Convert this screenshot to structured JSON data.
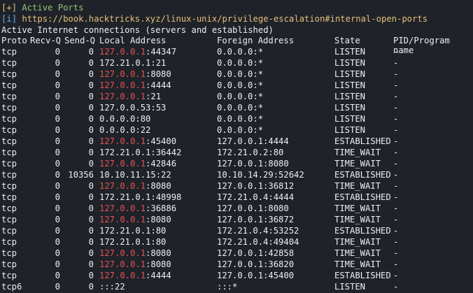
{
  "section": {
    "tag_open": "[",
    "tag_mark": "+",
    "tag_close": "]",
    "title": "Active Ports"
  },
  "info": {
    "tag_open": "[",
    "tag_mark": "i",
    "tag_close": "]",
    "url": "https://book.hacktricks.xyz/linux-unix/privilege-escalation#internal-open-ports"
  },
  "netstat_title": "Active Internet connections (servers and established)",
  "columns": {
    "proto": "Proto",
    "recv": "Recv-Q",
    "send": "Send-Q",
    "local": "Local Address",
    "foreign": "Foreign Address",
    "state": "State",
    "pid": "PID/Program name"
  },
  "rows": [
    {
      "proto": "tcp",
      "recv": "0",
      "send": "0",
      "local_host": "127.0.0.1",
      "local_port": ":44347",
      "local_hl": true,
      "foreign": "0.0.0.0:*",
      "state": "LISTEN",
      "pid": "-"
    },
    {
      "proto": "tcp",
      "recv": "0",
      "send": "0",
      "local_host": "172.21.0.1",
      "local_port": ":21",
      "local_hl": false,
      "foreign": "0.0.0.0:*",
      "state": "LISTEN",
      "pid": "-"
    },
    {
      "proto": "tcp",
      "recv": "0",
      "send": "0",
      "local_host": "127.0.0.1",
      "local_port": ":8080",
      "local_hl": true,
      "foreign": "0.0.0.0:*",
      "state": "LISTEN",
      "pid": "-"
    },
    {
      "proto": "tcp",
      "recv": "0",
      "send": "0",
      "local_host": "127.0.0.1",
      "local_port": ":4444",
      "local_hl": true,
      "foreign": "0.0.0.0:*",
      "state": "LISTEN",
      "pid": "-"
    },
    {
      "proto": "tcp",
      "recv": "0",
      "send": "0",
      "local_host": "127.0.0.1",
      "local_port": ":21",
      "local_hl": true,
      "foreign": "0.0.0.0:*",
      "state": "LISTEN",
      "pid": "-"
    },
    {
      "proto": "tcp",
      "recv": "0",
      "send": "0",
      "local_host": "127.0.0.53",
      "local_port": ":53",
      "local_hl": false,
      "foreign": "0.0.0.0:*",
      "state": "LISTEN",
      "pid": "-"
    },
    {
      "proto": "tcp",
      "recv": "0",
      "send": "0",
      "local_host": "0.0.0.0",
      "local_port": ":80",
      "local_hl": false,
      "foreign": "0.0.0.0:*",
      "state": "LISTEN",
      "pid": "-"
    },
    {
      "proto": "tcp",
      "recv": "0",
      "send": "0",
      "local_host": "0.0.0.0",
      "local_port": ":22",
      "local_hl": false,
      "foreign": "0.0.0.0:*",
      "state": "LISTEN",
      "pid": "-"
    },
    {
      "proto": "tcp",
      "recv": "0",
      "send": "0",
      "local_host": "127.0.0.1",
      "local_port": ":45400",
      "local_hl": true,
      "foreign": "127.0.0.1:4444",
      "state": "ESTABLISHED",
      "pid": "-"
    },
    {
      "proto": "tcp",
      "recv": "0",
      "send": "0",
      "local_host": "172.21.0.1",
      "local_port": ":36442",
      "local_hl": false,
      "foreign": "172.21.0.2:80",
      "state": "TIME_WAIT",
      "pid": "-"
    },
    {
      "proto": "tcp",
      "recv": "0",
      "send": "0",
      "local_host": "127.0.0.1",
      "local_port": ":42846",
      "local_hl": true,
      "foreign": "127.0.0.1:8080",
      "state": "TIME_WAIT",
      "pid": "-"
    },
    {
      "proto": "tcp",
      "recv": "0",
      "send": "10356",
      "local_host": "10.10.11.15",
      "local_port": ":22",
      "local_hl": false,
      "foreign": "10.10.14.29:52642",
      "state": "ESTABLISHED",
      "pid": "-"
    },
    {
      "proto": "tcp",
      "recv": "0",
      "send": "0",
      "local_host": "127.0.0.1",
      "local_port": ":8080",
      "local_hl": true,
      "foreign": "127.0.0.1:36812",
      "state": "TIME_WAIT",
      "pid": "-"
    },
    {
      "proto": "tcp",
      "recv": "0",
      "send": "0",
      "local_host": "172.21.0.1",
      "local_port": ":48998",
      "local_hl": false,
      "foreign": "172.21.0.4:4444",
      "state": "ESTABLISHED",
      "pid": "-"
    },
    {
      "proto": "tcp",
      "recv": "0",
      "send": "0",
      "local_host": "127.0.0.1",
      "local_port": ":36886",
      "local_hl": true,
      "foreign": "127.0.0.1:8080",
      "state": "TIME_WAIT",
      "pid": "-"
    },
    {
      "proto": "tcp",
      "recv": "0",
      "send": "0",
      "local_host": "127.0.0.1",
      "local_port": ":8080",
      "local_hl": true,
      "foreign": "127.0.0.1:36872",
      "state": "TIME_WAIT",
      "pid": "-"
    },
    {
      "proto": "tcp",
      "recv": "0",
      "send": "0",
      "local_host": "172.21.0.1",
      "local_port": ":80",
      "local_hl": false,
      "foreign": "172.21.0.4:53252",
      "state": "ESTABLISHED",
      "pid": "-"
    },
    {
      "proto": "tcp",
      "recv": "0",
      "send": "0",
      "local_host": "172.21.0.1",
      "local_port": ":80",
      "local_hl": false,
      "foreign": "172.21.0.4:49404",
      "state": "TIME_WAIT",
      "pid": "-"
    },
    {
      "proto": "tcp",
      "recv": "0",
      "send": "0",
      "local_host": "127.0.0.1",
      "local_port": ":8080",
      "local_hl": true,
      "foreign": "127.0.0.1:42858",
      "state": "TIME_WAIT",
      "pid": "-"
    },
    {
      "proto": "tcp",
      "recv": "0",
      "send": "0",
      "local_host": "127.0.0.1",
      "local_port": ":8080",
      "local_hl": true,
      "foreign": "127.0.0.1:36820",
      "state": "TIME_WAIT",
      "pid": "-"
    },
    {
      "proto": "tcp",
      "recv": "0",
      "send": "0",
      "local_host": "127.0.0.1",
      "local_port": ":4444",
      "local_hl": true,
      "foreign": "127.0.0.1:45400",
      "state": "ESTABLISHED",
      "pid": "-"
    },
    {
      "proto": "tcp6",
      "recv": "0",
      "send": "0",
      "local_host": ":::22",
      "local_port": "",
      "local_hl": false,
      "foreign": ":::*",
      "state": "LISTEN",
      "pid": "-"
    }
  ],
  "colors": {
    "background": "#1f2329",
    "text": "#eceff1",
    "section_marker": "#e5c07b",
    "section_title": "#98c379",
    "info_marker": "#61afef",
    "url": "#e5c07b",
    "highlight_localhost": "#e05252"
  }
}
